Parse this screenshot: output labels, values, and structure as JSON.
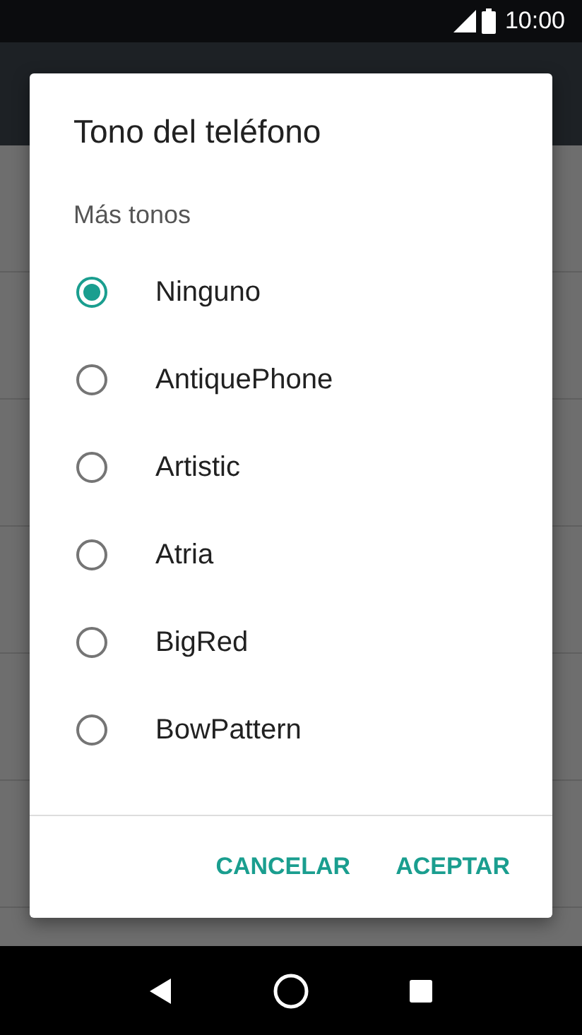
{
  "status_bar": {
    "time": "10:00"
  },
  "dialog": {
    "title": "Tono del teléfono",
    "section": "Más tonos",
    "options": [
      {
        "label": "Ninguno",
        "selected": true
      },
      {
        "label": "AntiquePhone",
        "selected": false
      },
      {
        "label": "Artistic",
        "selected": false
      },
      {
        "label": "Atria",
        "selected": false
      },
      {
        "label": "BigRed",
        "selected": false
      },
      {
        "label": "BowPattern",
        "selected": false
      }
    ],
    "buttons": [
      "CANCELAR",
      "ACEPTAR"
    ]
  }
}
